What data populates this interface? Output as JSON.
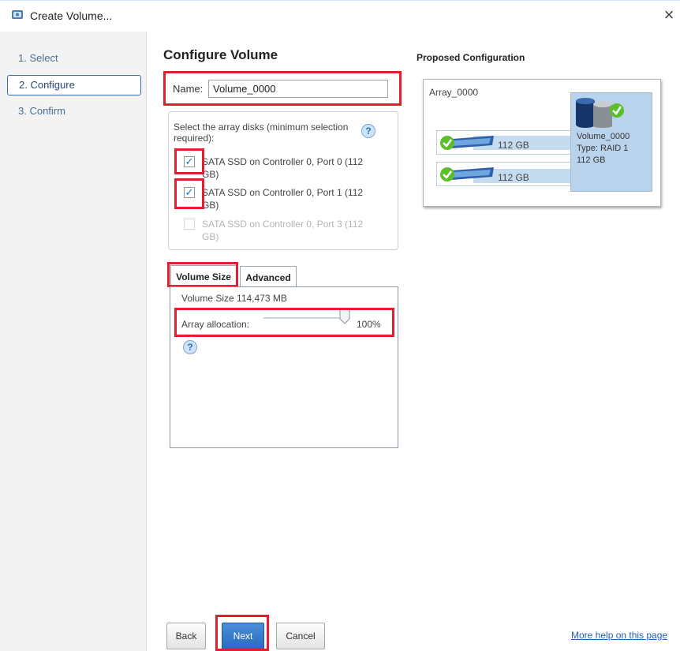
{
  "window": {
    "title": "Create Volume...",
    "close": "×"
  },
  "sidebar": {
    "items": [
      {
        "label": "1. Select"
      },
      {
        "label": "2. Configure"
      },
      {
        "label": "3. Confirm"
      }
    ]
  },
  "main": {
    "heading": "Configure Volume",
    "name_label": "Name:",
    "name_value": "Volume_0000",
    "disk_instructions": "Select the array disks (minimum selection required):",
    "disks": [
      {
        "label": "SATA SSD on Controller 0, Port 0 (112 GB)",
        "checked": true,
        "enabled": true
      },
      {
        "label": "SATA SSD on Controller 0, Port 1 (112 GB)",
        "checked": true,
        "enabled": true
      },
      {
        "label": "SATA SSD on Controller 0, Port 3 (112 GB)",
        "checked": false,
        "enabled": false
      }
    ],
    "tabs": [
      {
        "label": "Volume Size"
      },
      {
        "label": "Advanced"
      }
    ],
    "volume_size": "Volume Size 114,473 MB",
    "array_allocation_label": "Array allocation:",
    "array_allocation_value": "100%",
    "array_allocation_fraction": 1.0
  },
  "proposed": {
    "title": "Proposed Configuration",
    "array_name": "Array_0000",
    "disks": [
      {
        "size": "112 GB"
      },
      {
        "size": "112 GB"
      }
    ],
    "volume": {
      "name": "Volume_0000",
      "type": "Type: RAID 1",
      "size": "112 GB"
    }
  },
  "footer": {
    "back": "Back",
    "next": "Next",
    "cancel": "Cancel",
    "help_link": "More help on this page"
  },
  "colors": {
    "accent": "#2f6ec2",
    "highlight": "#e0202e",
    "check_green": "#5bbf2a"
  }
}
